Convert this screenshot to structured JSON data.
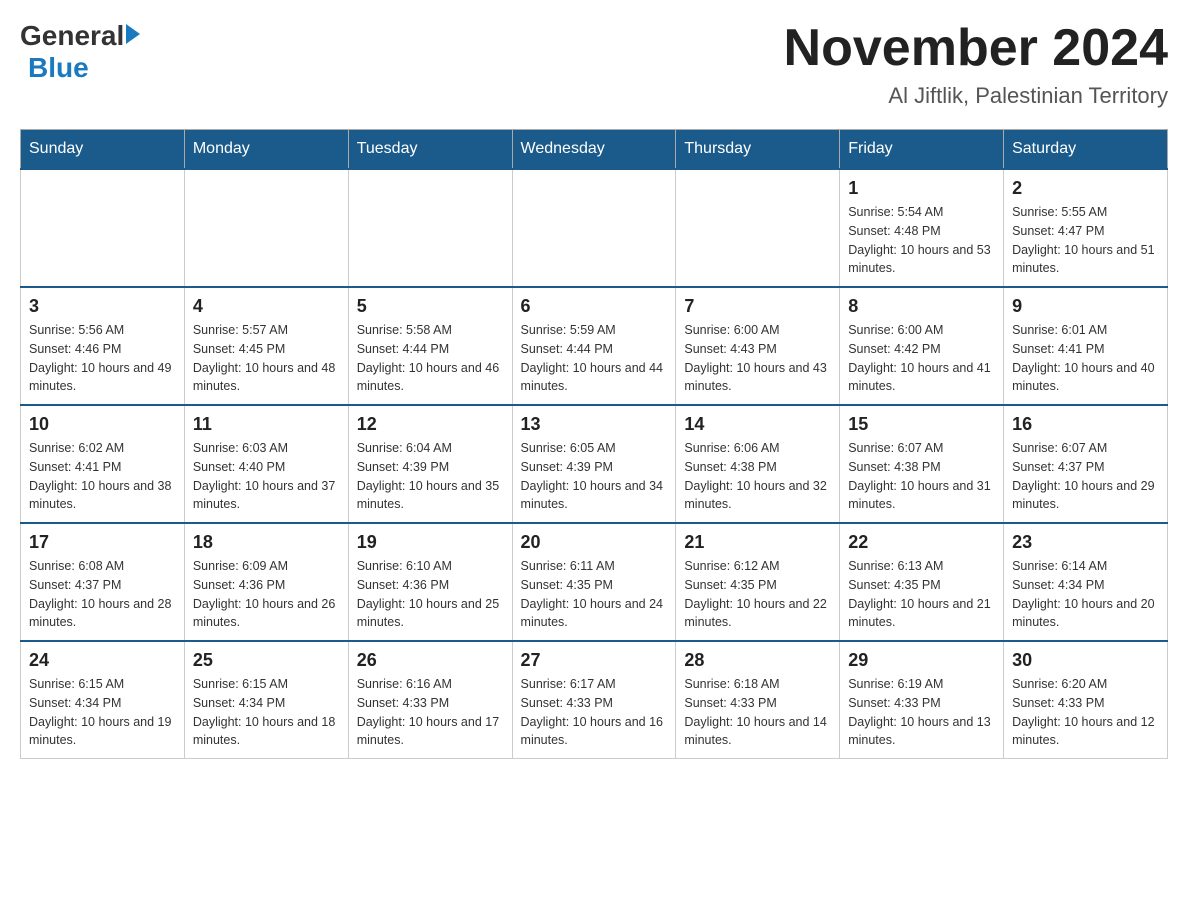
{
  "logo": {
    "general": "General",
    "blue": "Blue"
  },
  "header": {
    "title": "November 2024",
    "subtitle": "Al Jiftlik, Palestinian Territory"
  },
  "weekdays": [
    "Sunday",
    "Monday",
    "Tuesday",
    "Wednesday",
    "Thursday",
    "Friday",
    "Saturday"
  ],
  "weeks": [
    [
      {
        "day": "",
        "info": ""
      },
      {
        "day": "",
        "info": ""
      },
      {
        "day": "",
        "info": ""
      },
      {
        "day": "",
        "info": ""
      },
      {
        "day": "",
        "info": ""
      },
      {
        "day": "1",
        "info": "Sunrise: 5:54 AM\nSunset: 4:48 PM\nDaylight: 10 hours and 53 minutes."
      },
      {
        "day": "2",
        "info": "Sunrise: 5:55 AM\nSunset: 4:47 PM\nDaylight: 10 hours and 51 minutes."
      }
    ],
    [
      {
        "day": "3",
        "info": "Sunrise: 5:56 AM\nSunset: 4:46 PM\nDaylight: 10 hours and 49 minutes."
      },
      {
        "day": "4",
        "info": "Sunrise: 5:57 AM\nSunset: 4:45 PM\nDaylight: 10 hours and 48 minutes."
      },
      {
        "day": "5",
        "info": "Sunrise: 5:58 AM\nSunset: 4:44 PM\nDaylight: 10 hours and 46 minutes."
      },
      {
        "day": "6",
        "info": "Sunrise: 5:59 AM\nSunset: 4:44 PM\nDaylight: 10 hours and 44 minutes."
      },
      {
        "day": "7",
        "info": "Sunrise: 6:00 AM\nSunset: 4:43 PM\nDaylight: 10 hours and 43 minutes."
      },
      {
        "day": "8",
        "info": "Sunrise: 6:00 AM\nSunset: 4:42 PM\nDaylight: 10 hours and 41 minutes."
      },
      {
        "day": "9",
        "info": "Sunrise: 6:01 AM\nSunset: 4:41 PM\nDaylight: 10 hours and 40 minutes."
      }
    ],
    [
      {
        "day": "10",
        "info": "Sunrise: 6:02 AM\nSunset: 4:41 PM\nDaylight: 10 hours and 38 minutes."
      },
      {
        "day": "11",
        "info": "Sunrise: 6:03 AM\nSunset: 4:40 PM\nDaylight: 10 hours and 37 minutes."
      },
      {
        "day": "12",
        "info": "Sunrise: 6:04 AM\nSunset: 4:39 PM\nDaylight: 10 hours and 35 minutes."
      },
      {
        "day": "13",
        "info": "Sunrise: 6:05 AM\nSunset: 4:39 PM\nDaylight: 10 hours and 34 minutes."
      },
      {
        "day": "14",
        "info": "Sunrise: 6:06 AM\nSunset: 4:38 PM\nDaylight: 10 hours and 32 minutes."
      },
      {
        "day": "15",
        "info": "Sunrise: 6:07 AM\nSunset: 4:38 PM\nDaylight: 10 hours and 31 minutes."
      },
      {
        "day": "16",
        "info": "Sunrise: 6:07 AM\nSunset: 4:37 PM\nDaylight: 10 hours and 29 minutes."
      }
    ],
    [
      {
        "day": "17",
        "info": "Sunrise: 6:08 AM\nSunset: 4:37 PM\nDaylight: 10 hours and 28 minutes."
      },
      {
        "day": "18",
        "info": "Sunrise: 6:09 AM\nSunset: 4:36 PM\nDaylight: 10 hours and 26 minutes."
      },
      {
        "day": "19",
        "info": "Sunrise: 6:10 AM\nSunset: 4:36 PM\nDaylight: 10 hours and 25 minutes."
      },
      {
        "day": "20",
        "info": "Sunrise: 6:11 AM\nSunset: 4:35 PM\nDaylight: 10 hours and 24 minutes."
      },
      {
        "day": "21",
        "info": "Sunrise: 6:12 AM\nSunset: 4:35 PM\nDaylight: 10 hours and 22 minutes."
      },
      {
        "day": "22",
        "info": "Sunrise: 6:13 AM\nSunset: 4:35 PM\nDaylight: 10 hours and 21 minutes."
      },
      {
        "day": "23",
        "info": "Sunrise: 6:14 AM\nSunset: 4:34 PM\nDaylight: 10 hours and 20 minutes."
      }
    ],
    [
      {
        "day": "24",
        "info": "Sunrise: 6:15 AM\nSunset: 4:34 PM\nDaylight: 10 hours and 19 minutes."
      },
      {
        "day": "25",
        "info": "Sunrise: 6:15 AM\nSunset: 4:34 PM\nDaylight: 10 hours and 18 minutes."
      },
      {
        "day": "26",
        "info": "Sunrise: 6:16 AM\nSunset: 4:33 PM\nDaylight: 10 hours and 17 minutes."
      },
      {
        "day": "27",
        "info": "Sunrise: 6:17 AM\nSunset: 4:33 PM\nDaylight: 10 hours and 16 minutes."
      },
      {
        "day": "28",
        "info": "Sunrise: 6:18 AM\nSunset: 4:33 PM\nDaylight: 10 hours and 14 minutes."
      },
      {
        "day": "29",
        "info": "Sunrise: 6:19 AM\nSunset: 4:33 PM\nDaylight: 10 hours and 13 minutes."
      },
      {
        "day": "30",
        "info": "Sunrise: 6:20 AM\nSunset: 4:33 PM\nDaylight: 10 hours and 12 minutes."
      }
    ]
  ]
}
